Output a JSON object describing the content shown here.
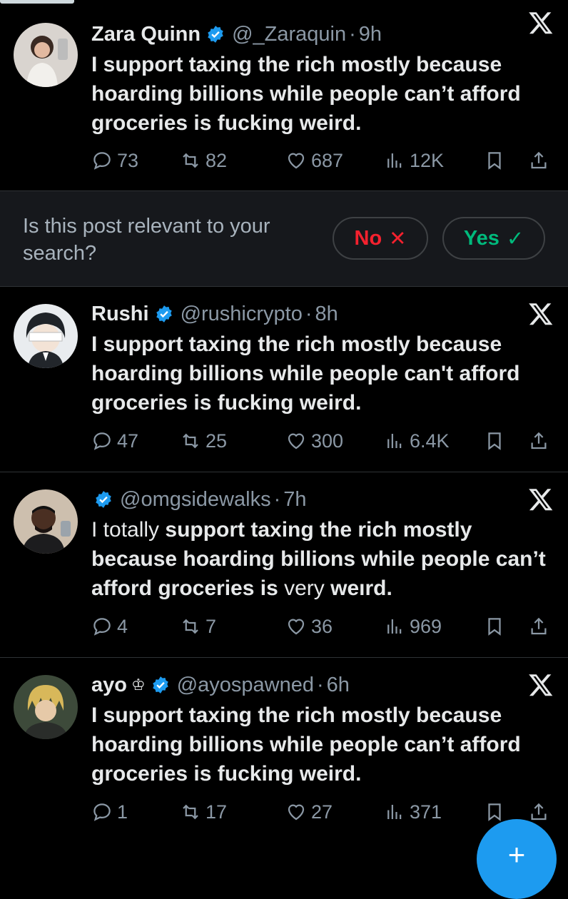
{
  "tweets": [
    {
      "name": "Zara Quinn",
      "handle": "@_Zaraquin",
      "time": "9h",
      "text": "I support taxing the rich mostly because hoarding billions while people can’t afford groceries is fucking weird.",
      "replies": "73",
      "reposts": "82",
      "likes": "687",
      "views": "12K"
    },
    {
      "name": "Rushi",
      "handle": "@rushicrypto",
      "time": "8h",
      "text": "I support taxing the rich mostly because hoarding billions while people can't afford groceries is fucking weird.",
      "replies": "47",
      "reposts": "25",
      "likes": "300",
      "views": "6.4K"
    },
    {
      "name": "",
      "handle": "@omgsidewalks",
      "time": "7h",
      "text_parts": [
        "I ",
        "totally",
        " support taxing the rich mostly because hoarding billions while people can’t afford groceries is ",
        "very ",
        "weırd",
        "."
      ],
      "replies": "4",
      "reposts": "7",
      "likes": "36",
      "views": "969"
    },
    {
      "name": "ayo",
      "crown": "♔",
      "handle": "@ayospawned",
      "time": "6h",
      "text": "I support taxing the rich mostly because hoarding billions while people can’t afford groceries is fucking weird.",
      "replies": "1",
      "reposts": "17",
      "likes": "27",
      "views": "371"
    }
  ],
  "survey": {
    "question": "Is this post relevant to your search?",
    "no_label": "No",
    "no_symbol": "✕",
    "yes_label": "Yes",
    "yes_symbol": "✓"
  },
  "separator_dot": "·",
  "fab_symbol": "+",
  "colors": {
    "background": "#000000",
    "verified": "#1d9bf0",
    "muted": "#8b98a5",
    "no": "#f4212e",
    "yes": "#00ba7c"
  },
  "icons": [
    "verified-badge-icon",
    "x-logo-icon",
    "reply-icon",
    "repost-icon",
    "like-icon",
    "views-icon",
    "bookmark-icon",
    "share-icon"
  ]
}
